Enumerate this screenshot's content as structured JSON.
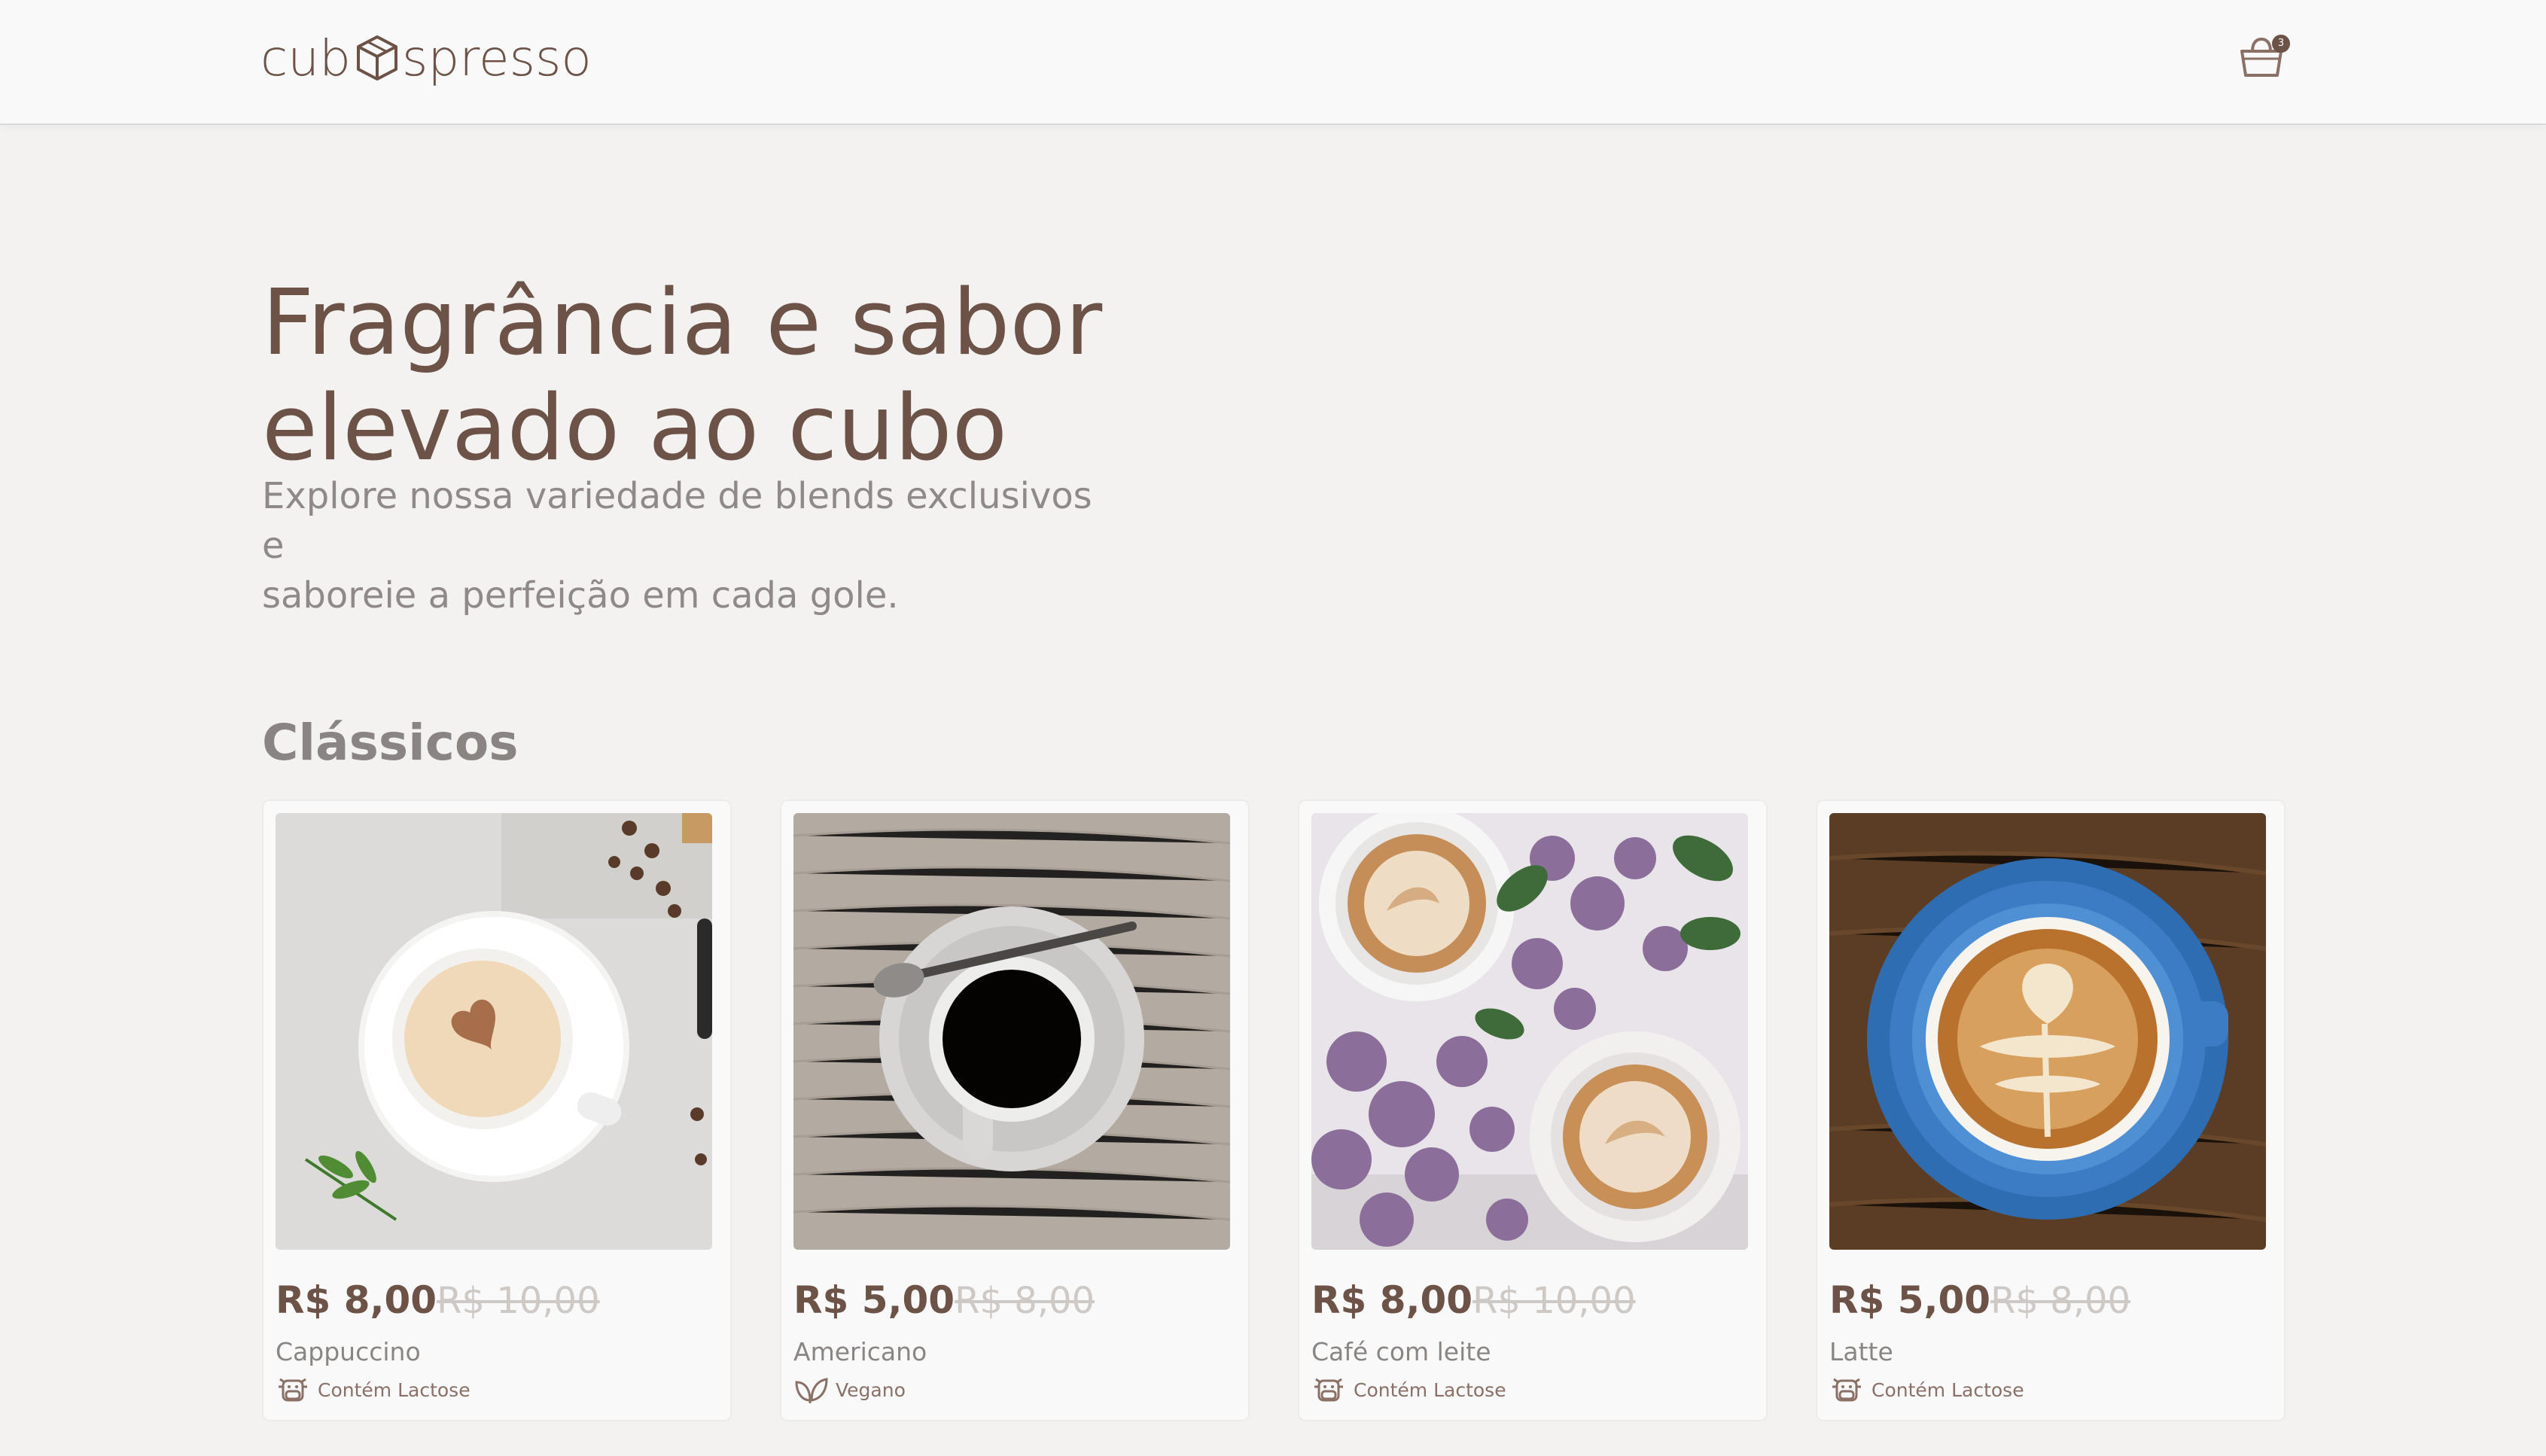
{
  "header": {
    "logo_left": "cub",
    "logo_right": "spresso",
    "cart_count": "3"
  },
  "hero": {
    "title_line1": "Fragrância e sabor",
    "title_line2": "elevado ao cubo",
    "subtitle_line1": "Explore nossa variedade de blends exclusivos e",
    "subtitle_line2": "saboreie a perfeição em cada gole."
  },
  "section": {
    "title": "Clássicos"
  },
  "products": [
    {
      "price": "R$ 8,00",
      "old_price": "R$ 10,00",
      "name": "Cappuccino",
      "tag": "Contém Lactose",
      "tag_icon": "cow-icon"
    },
    {
      "price": "R$ 5,00",
      "old_price": "R$ 8,00",
      "name": "Americano",
      "tag": "Vegano",
      "tag_icon": "leaf-icon"
    },
    {
      "price": "R$ 8,00",
      "old_price": "R$ 10,00",
      "name": "Café com leite",
      "tag": "Contém Lactose",
      "tag_icon": "cow-icon"
    },
    {
      "price": "R$ 5,00",
      "old_price": "R$ 8,00",
      "name": "Latte",
      "tag": "Contém Lactose",
      "tag_icon": "cow-icon"
    }
  ],
  "colors": {
    "brand": "#6d5247",
    "background": "#f3f2f1",
    "muted_text": "#8a8583"
  }
}
